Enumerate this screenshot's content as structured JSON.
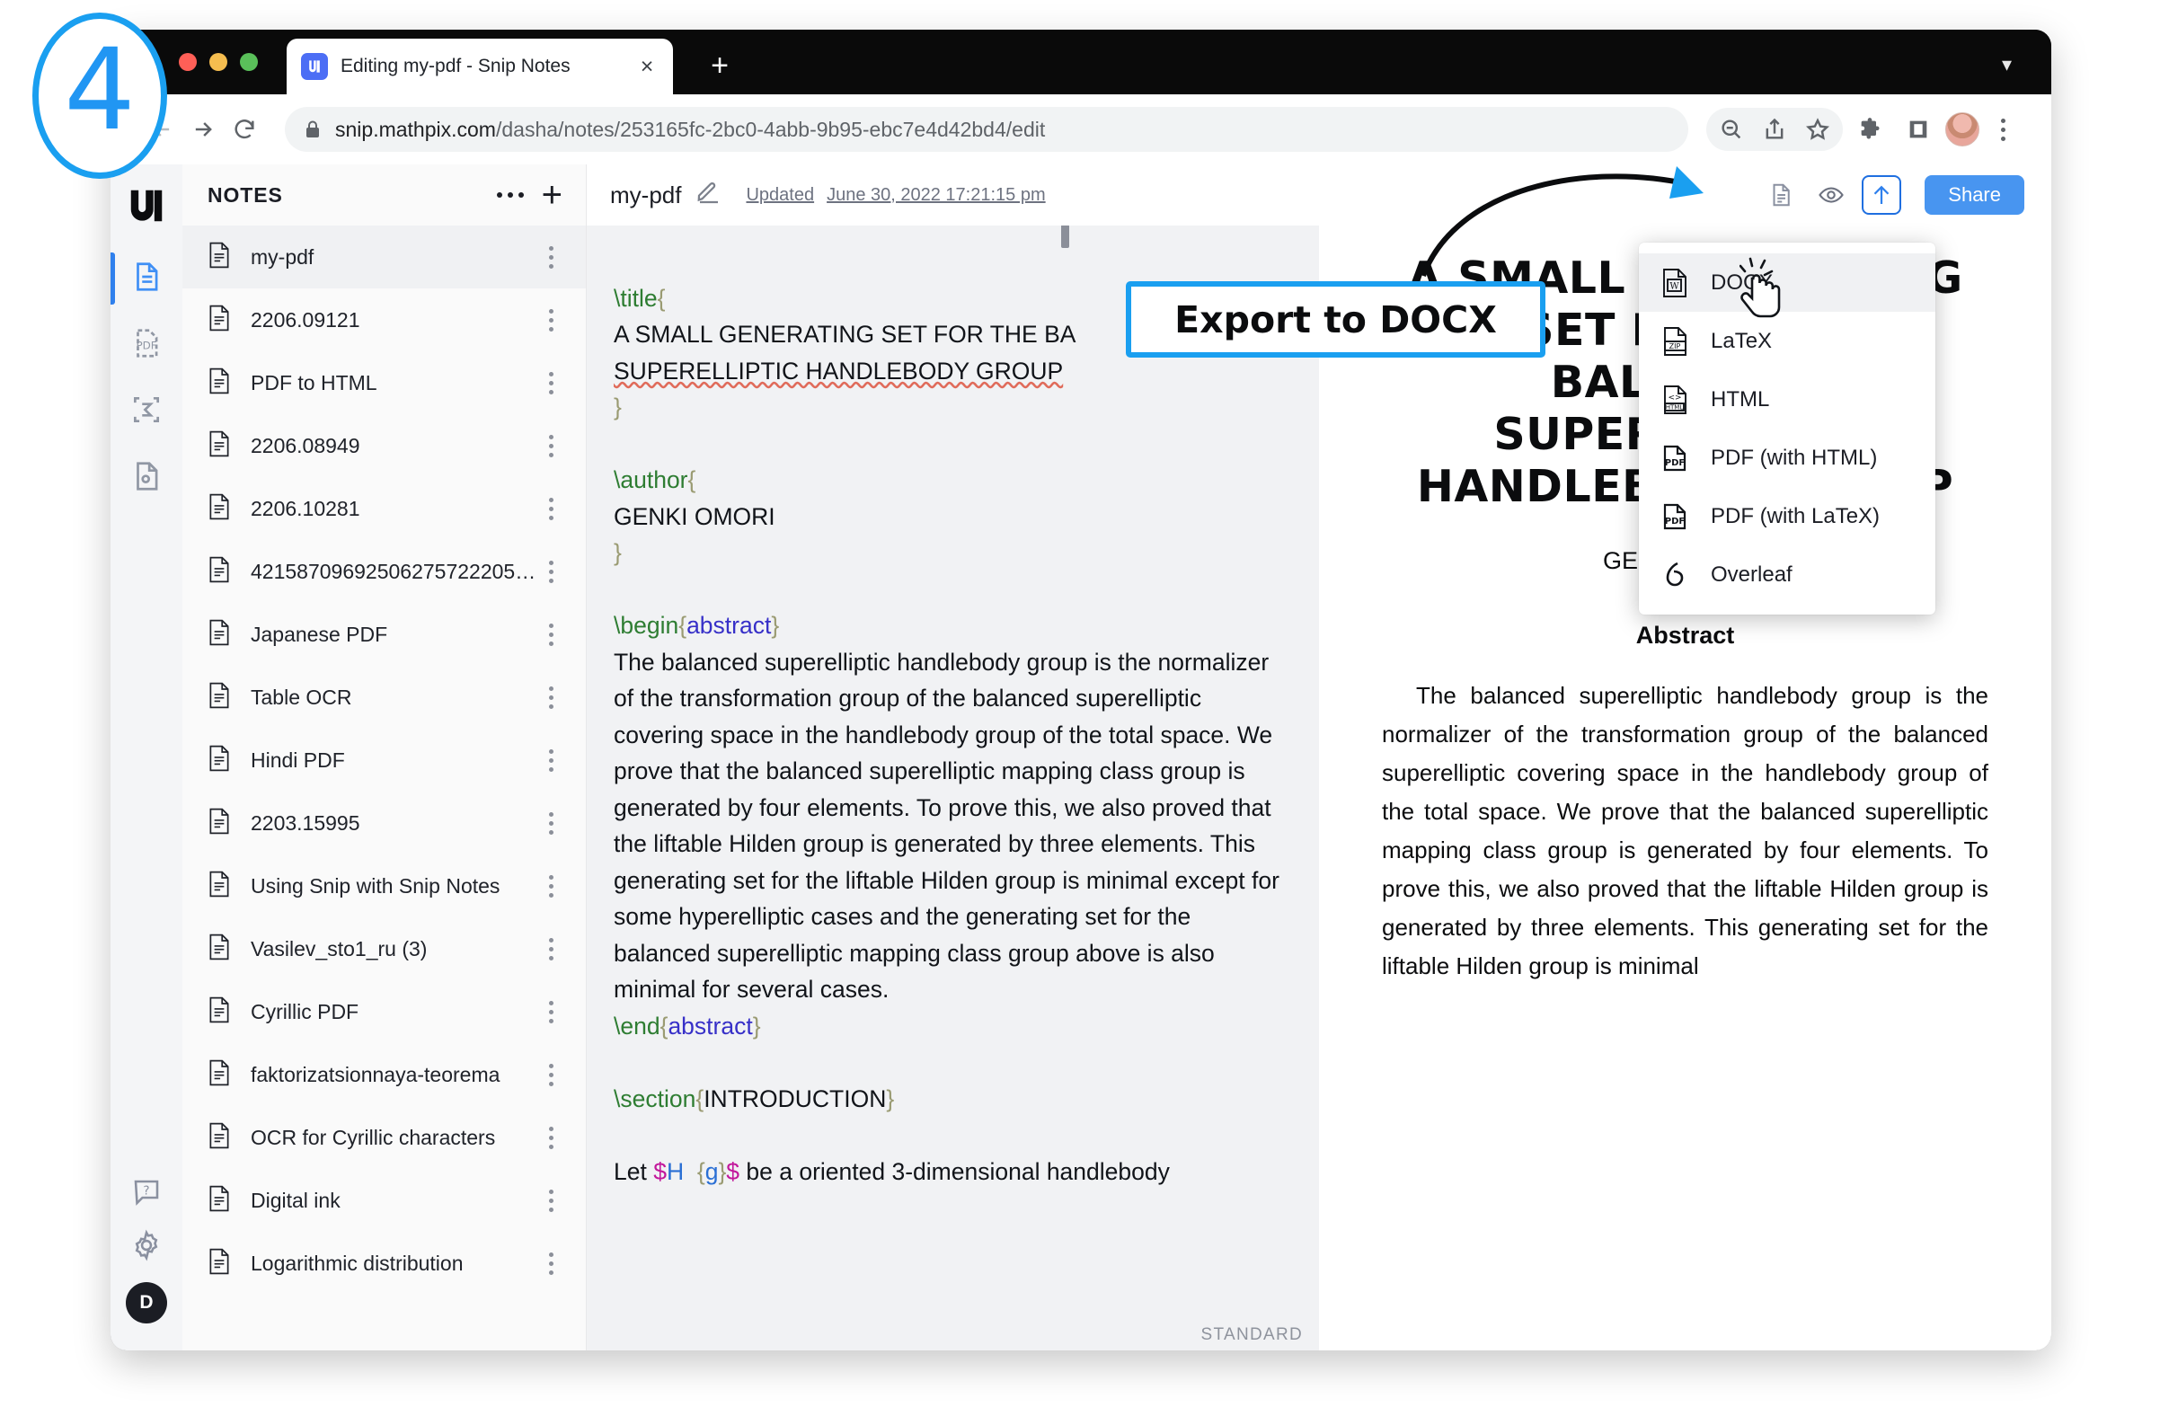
{
  "annotation": {
    "step_number": "4",
    "callout_label": "Export to DOCX"
  },
  "browser": {
    "tab": {
      "title": "Editing my-pdf - Snip Notes",
      "favicon_icon": "snip-logo-icon",
      "close_icon": "close-icon"
    },
    "new_tab_icon": "plus-icon",
    "window_collapse_icon": "chevron-down-icon",
    "nav": {
      "back_icon": "arrow-left-icon",
      "forward_icon": "arrow-right-icon",
      "reload_icon": "reload-icon"
    },
    "omnibox": {
      "lock_icon": "lock-icon",
      "url_host": "snip.mathpix.com",
      "url_path": "/dasha/notes/253165fc-2bc0-4abb-9b95-ebc7e4d42bd4/edit"
    },
    "toolbar_icons": [
      "zoom-out-icon",
      "share-icon",
      "bookmark-star-icon",
      "extensions-puzzle-icon",
      "side-panel-icon",
      "profile-avatar",
      "browser-menu-kebab-icon"
    ]
  },
  "rail": {
    "logo_icon": "mathpix-snip-logo-icon",
    "items": [
      {
        "icon": "notes-document-icon",
        "active": true
      },
      {
        "icon": "pdf-file-icon",
        "active": false
      },
      {
        "icon": "snip-sigma-icon",
        "active": false
      },
      {
        "icon": "image-ocr-icon",
        "active": false
      }
    ],
    "bottom": {
      "help_icon": "help-question-icon",
      "settings_icon": "gear-icon",
      "avatar_initial": "D"
    }
  },
  "notes_panel": {
    "title": "NOTES",
    "more_icon": "more-dots-icon",
    "add_icon": "plus-icon",
    "items": [
      {
        "label": "my-pdf",
        "selected": true
      },
      {
        "label": "2206.09121",
        "selected": false
      },
      {
        "label": "PDF to HTML",
        "selected": false
      },
      {
        "label": "2206.08949",
        "selected": false
      },
      {
        "label": "2206.10281",
        "selected": false
      },
      {
        "label": "42158709692506275722205…",
        "selected": false
      },
      {
        "label": "Japanese PDF",
        "selected": false
      },
      {
        "label": "Table OCR",
        "selected": false
      },
      {
        "label": "Hindi PDF",
        "selected": false
      },
      {
        "label": "2203.15995",
        "selected": false
      },
      {
        "label": "Using Snip with Snip Notes",
        "selected": false
      },
      {
        "label": "Vasilev_sto1_ru (3)",
        "selected": false
      },
      {
        "label": "Cyrillic PDF",
        "selected": false
      },
      {
        "label": "faktorizatsionnaya-teorema",
        "selected": false
      },
      {
        "label": "OCR for Cyrillic characters",
        "selected": false
      },
      {
        "label": "Digital ink",
        "selected": false
      },
      {
        "label": "Logarithmic distribution",
        "selected": false
      }
    ]
  },
  "editor_header": {
    "note_name": "my-pdf",
    "edit_icon": "pencil-icon",
    "updated_label": "Updated",
    "updated_date": "June 30, 2022 17:21:15 pm",
    "document_icon": "document-view-icon",
    "preview_icon": "eye-preview-icon",
    "export_icon": "export-upload-icon",
    "share_label": "Share"
  },
  "source_pane": {
    "status_badge": "STANDARD",
    "lines": {
      "title_cmd": "\\title",
      "title_text_1": "A SMALL GENERATING SET FOR THE BA",
      "title_text_2": "SUPERELLIPTIC HANDLEBODY GROUP",
      "author_cmd": "\\author",
      "author_text": "GENKI OMORI",
      "begin_cmd": "\\begin",
      "abstract_env": "abstract",
      "abstract_text": "The balanced superelliptic handlebody group is the normalizer of the transformation group of the balanced superelliptic covering space in the handlebody group of the total space. We prove that the balanced superelliptic mapping class group is generated by four elements. To prove this, we also proved that the liftable Hilden group is generated by three elements. This generating set for the liftable Hilden group is minimal except for some hyperelliptic cases and the generating set for the balanced superelliptic mapping class group above is also minimal for several cases.",
      "end_cmd": "\\end",
      "section_cmd": "\\section",
      "section_text": "INTRODUCTION",
      "body_text_prefix": "Let ",
      "body_math": "$H {g}$",
      "body_text_suffix": " be a oriented 3-dimensional handlebody"
    }
  },
  "preview_pane": {
    "title": "A SMALL GENERATING SET FOR THE BALANCED SUPERELLIPTIC HANDLEBODY GROUP",
    "author": "GENKI OMORI",
    "abstract_heading": "Abstract",
    "abstract_body": "The balanced superelliptic handlebody group is the normalizer of the transformation group of the balanced superelliptic covering space in the handlebody group of the total space. We prove that the balanced superelliptic mapping class group is generated by four elements. To prove this, we also proved that the liftable Hilden group is generated by three elements. This generating set for the liftable Hilden group is minimal"
  },
  "export_menu": {
    "items": [
      {
        "label": "DOCX",
        "icon": "word-docx-file-icon",
        "highlighted": true
      },
      {
        "label": "LaTeX",
        "icon": "zip-file-icon",
        "highlighted": false
      },
      {
        "label": "HTML",
        "icon": "html-file-icon",
        "highlighted": false
      },
      {
        "label": "PDF (with HTML)",
        "icon": "pdf-file-icon",
        "highlighted": false
      },
      {
        "label": "PDF (with LaTeX)",
        "icon": "pdf-file-icon",
        "highlighted": false
      },
      {
        "label": "Overleaf",
        "icon": "overleaf-icon",
        "highlighted": false
      }
    ],
    "cursor_icon": "pointing-hand-click-cursor"
  },
  "colors": {
    "accent_blue": "#1a9ff0",
    "share_blue": "#4895f0",
    "rail_active": "#2f80ed",
    "latex_command_green": "#2e7d32",
    "latex_env_blue": "#3730c8",
    "latex_dollar_magenta": "#c2179b",
    "spellcheck_red": "#e06b5a"
  }
}
